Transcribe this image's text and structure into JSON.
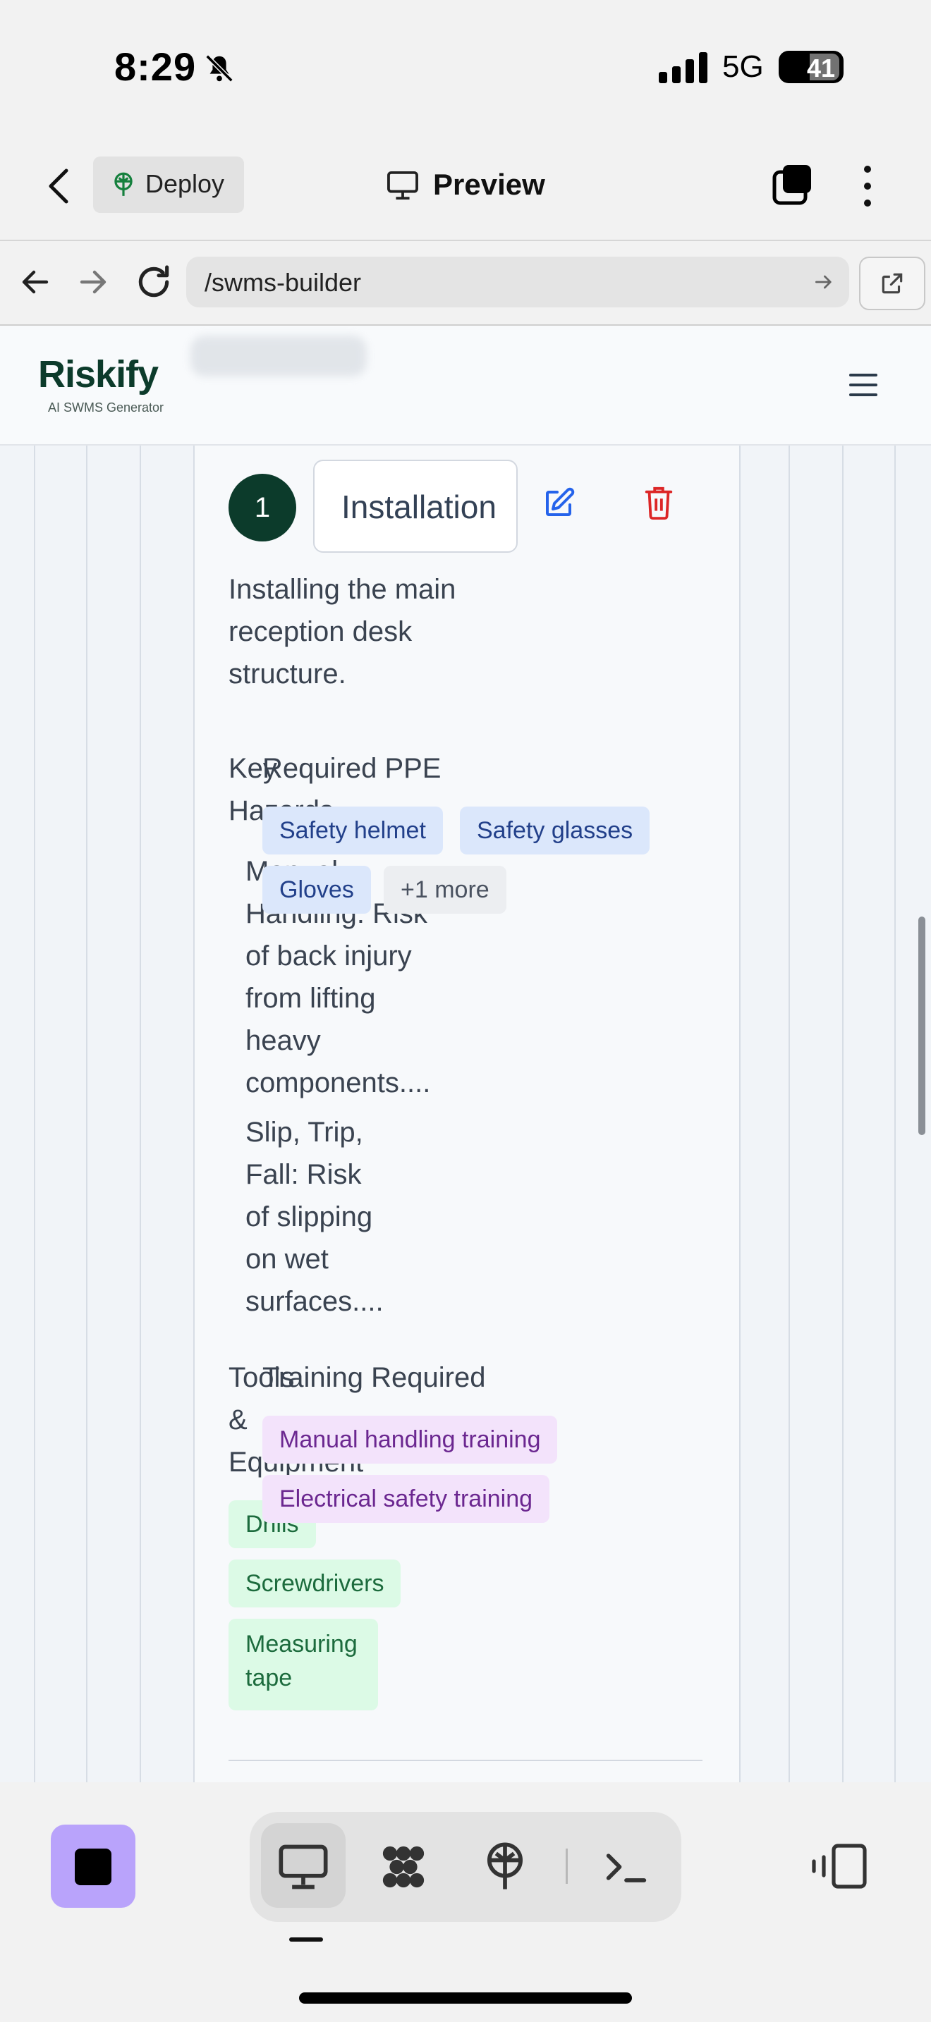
{
  "status_bar": {
    "time": "8:29",
    "network": "5G",
    "battery": "41"
  },
  "toolbar": {
    "deploy_label": "Deploy",
    "preview_label": "Preview"
  },
  "browser": {
    "url": "/swms-builder"
  },
  "site": {
    "logo_text": "Riskify",
    "logo_subtitle": "AI SWMS Generator"
  },
  "step": {
    "number": "1",
    "title_value": "Installation",
    "description": "Installing the main reception desk structure.",
    "hazards_label": "Key Hazards",
    "hazards": [
      "Manual Handling: Risk of back injury from lifting heavy components....",
      "Slip, Trip, Fall: Risk of slipping on wet surfaces...."
    ],
    "ppe_label": "Required PPE",
    "ppe": [
      "Safety helmet",
      "Safety glasses",
      "Gloves",
      "+1 more"
    ],
    "tools_label": "Tools & Equipment",
    "tools": [
      "Drills",
      "Screwdrivers",
      "Measuring tape"
    ],
    "training_label": "Training Required",
    "training": [
      "Manual handling training",
      "Electrical safety training"
    ]
  },
  "colors": {
    "brand_dark_green": "#0c3b2b",
    "edit_blue": "#2563eb",
    "delete_red": "#dc2626",
    "stop_button": "#b9a3fb"
  },
  "icons": [
    "bell-slash-icon",
    "signal-icon",
    "battery-icon",
    "back-chevron-icon",
    "deploy-icon",
    "monitor-icon",
    "tabs-icon",
    "kebab-menu-icon",
    "arrow-left-icon",
    "arrow-right-icon",
    "reload-icon",
    "external-link-icon",
    "hamburger-icon",
    "edit-icon",
    "trash-icon",
    "stop-icon",
    "desktop-icon",
    "grid-icon",
    "deploy-icon",
    "terminal-icon",
    "side-panel-icon"
  ]
}
